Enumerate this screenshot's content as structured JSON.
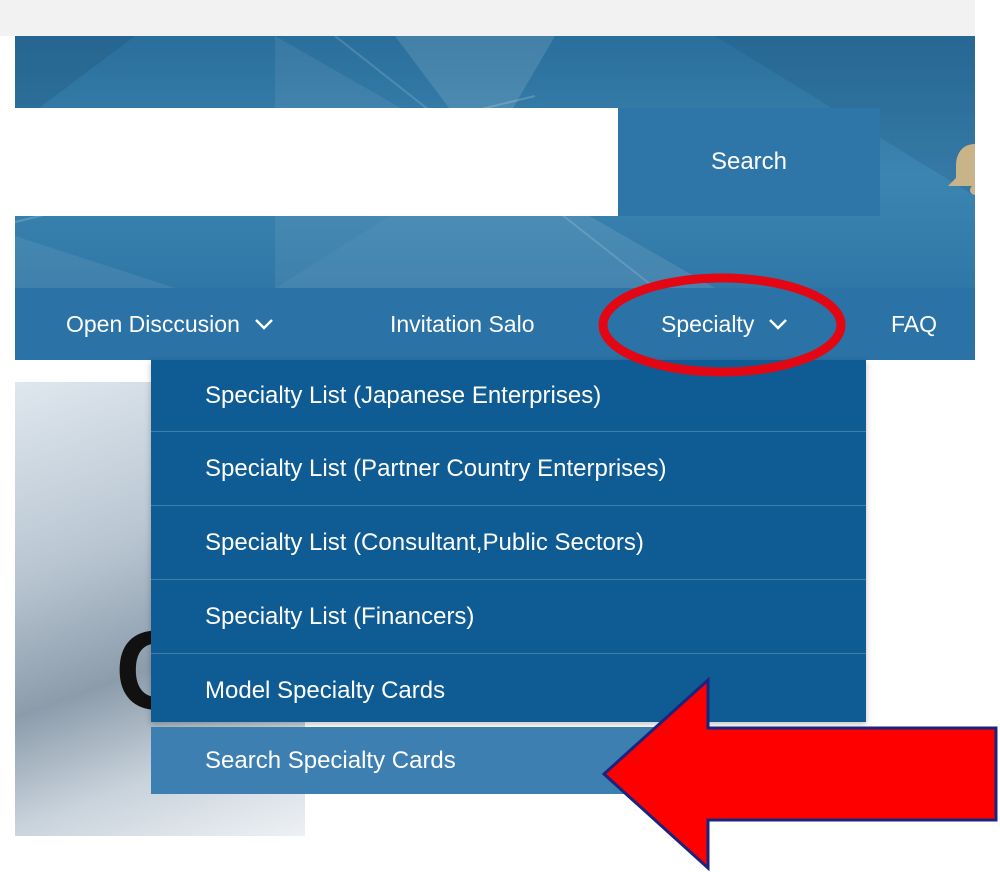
{
  "search": {
    "placeholder": "",
    "button_label": "Search"
  },
  "nav": {
    "items": [
      {
        "label": "Open Disccusion",
        "has_dropdown": true
      },
      {
        "label": "Invitation Salo",
        "has_dropdown": false
      },
      {
        "label": "Specialty",
        "has_dropdown": true
      },
      {
        "label": "FAQ",
        "has_dropdown": false
      }
    ]
  },
  "dropdown": {
    "items": [
      {
        "label": "Specialty List (Japanese Enterprises)"
      },
      {
        "label": "Specialty List (Partner Country Enterprises)"
      },
      {
        "label": "Specialty List (Consultant,Public Sectors)"
      },
      {
        "label": "Specialty List (Financers)"
      },
      {
        "label": "Model Specialty Cards"
      },
      {
        "label": "Search Specialty Cards"
      }
    ]
  },
  "colors": {
    "header": "#3c84b1",
    "navbar": "#2b72a7",
    "dropdown": "#0f5b93",
    "dropdown_highlight": "#3d7fb1",
    "annotation": "#e30613"
  },
  "icons": {
    "bell": "bell-icon",
    "chevron": "chevron-down-icon"
  }
}
